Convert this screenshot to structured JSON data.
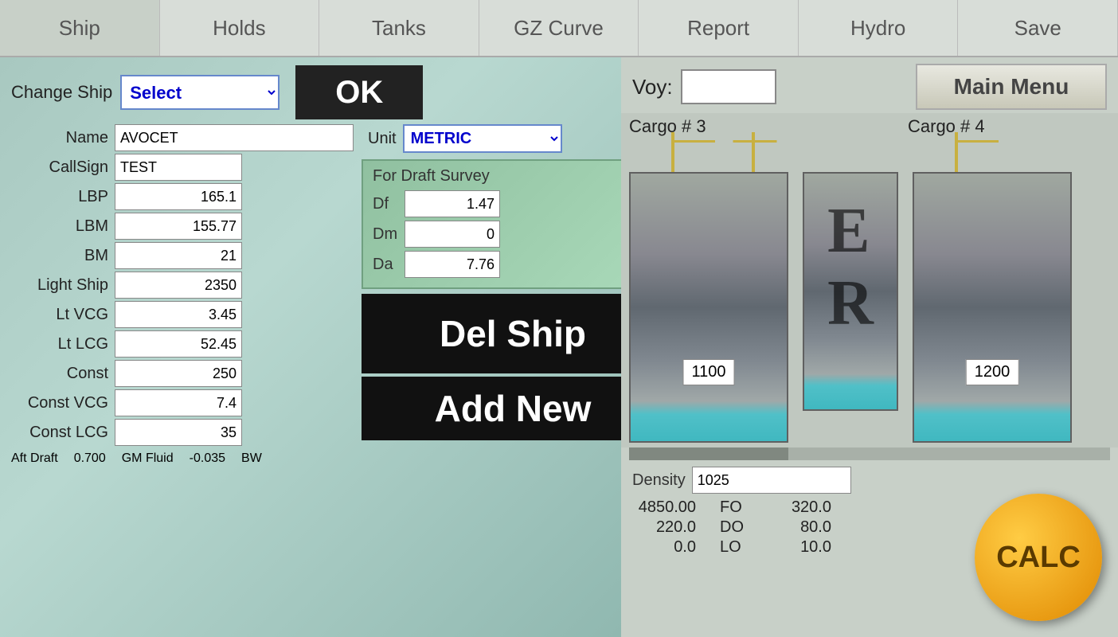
{
  "nav": {
    "items": [
      {
        "label": "Ship",
        "key": "ship"
      },
      {
        "label": "Holds",
        "key": "holds"
      },
      {
        "label": "Tanks",
        "key": "tanks"
      },
      {
        "label": "GZ Curve",
        "key": "gz-curve"
      },
      {
        "label": "Report",
        "key": "report"
      },
      {
        "label": "Hydro",
        "key": "hydro"
      },
      {
        "label": "Save",
        "key": "save"
      }
    ]
  },
  "left": {
    "change_ship_label": "Change Ship",
    "select_value": "Select",
    "ok_label": "OK",
    "name_label": "Name",
    "name_value": "AVOCET",
    "callsign_label": "CallSign",
    "callsign_value": "TEST",
    "unit_label": "Unit",
    "unit_value": "METRIC",
    "lbp_label": "LBP",
    "lbp_value": "165.1",
    "lbm_label": "LBM",
    "lbm_value": "155.77",
    "bm_label": "BM",
    "bm_value": "21",
    "light_ship_label": "Light Ship",
    "light_ship_value": "2350",
    "lt_vcg_label": "Lt VCG",
    "lt_vcg_value": "3.45",
    "lt_lcg_label": "Lt LCG",
    "lt_lcg_value": "52.45",
    "const_label": "Const",
    "const_value": "250",
    "const_vcg_label": "Const VCG",
    "const_vcg_value": "7.4",
    "const_lcg_label": "Const LCG",
    "const_lcg_value": "35",
    "aft_draft_label": "Aft Draft",
    "aft_draft_value": "0.700",
    "gm_fluid_label": "GM Fluid",
    "gm_fluid_value": "-0.035",
    "bw_label": "BW",
    "draft_survey": {
      "title": "For Draft Survey",
      "df_label": "Df",
      "df_value": "1.47",
      "dm_label": "Dm",
      "dm_value": "0",
      "da_label": "Da",
      "da_value": "7.76"
    },
    "del_ship_label": "Del Ship",
    "add_new_label": "Add New"
  },
  "right": {
    "voy_label": "Voy:",
    "voy_value": "",
    "main_menu_label": "Main Menu",
    "cargo3_label": "Cargo # 3",
    "cargo4_label": "Cargo # 4",
    "hold3_value": "1100",
    "hold4_value": "1200",
    "er_label": "E\nR",
    "density_label": "Density",
    "density_value": "1025",
    "data_rows": [
      {
        "val1": "4850.00",
        "label": "FO",
        "val2": "320.0"
      },
      {
        "val1": "220.0",
        "label": "DO",
        "val2": "80.0"
      },
      {
        "val1": "0.0",
        "label": "LO",
        "val2": "10.0"
      }
    ],
    "calc_label": "CALC"
  }
}
